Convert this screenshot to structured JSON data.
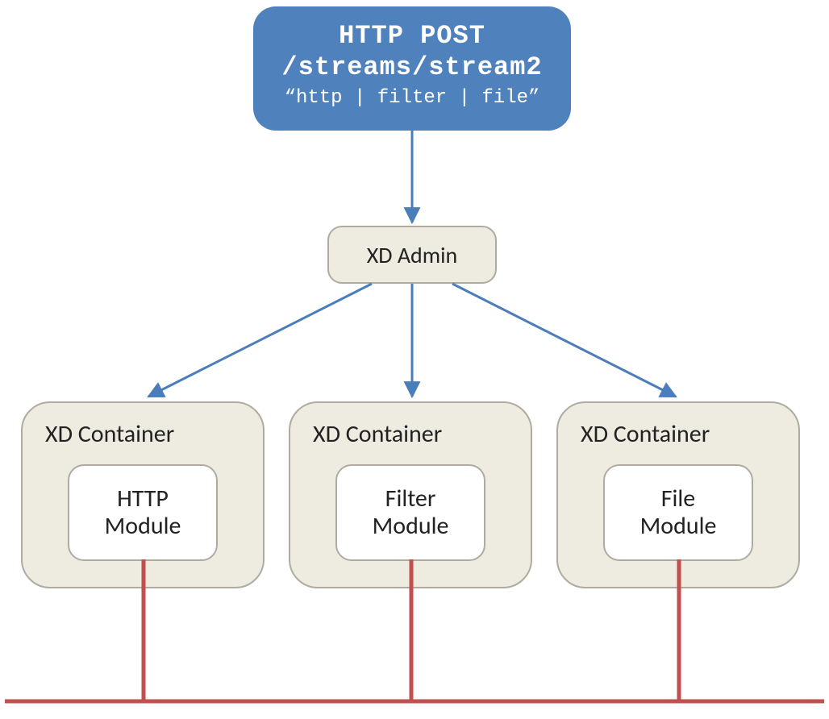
{
  "httpPost": {
    "method": "HTTP POST",
    "path": "/streams/stream2",
    "body": "“http | filter |  file”"
  },
  "admin": {
    "label": "XD Admin"
  },
  "containers": [
    {
      "title": "XD Container",
      "moduleLine1": "HTTP",
      "moduleLine2": "Module"
    },
    {
      "title": "XD Container",
      "moduleLine1": "Filter",
      "moduleLine2": "Module"
    },
    {
      "title": "XD Container",
      "moduleLine1": "File",
      "moduleLine2": "Module"
    }
  ],
  "colors": {
    "blueBox": "#4F81BD",
    "beigeBox": "#EEECE1",
    "beigeBorder": "#B0ABA0",
    "arrowBlue": "#4A7EBB",
    "busRed": "#C0504D"
  }
}
